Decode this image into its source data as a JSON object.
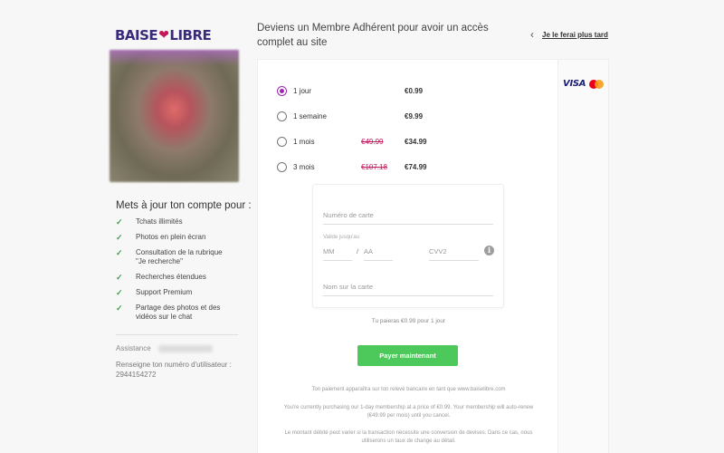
{
  "logo": {
    "word1": "BAISE",
    "heart": "❤",
    "word2": "LIBRE"
  },
  "sidebar": {
    "upgrade_title": "Mets à jour ton compte pour :",
    "features": [
      "Tchats illimités",
      "Photos en plein écran",
      "Consultation de la rubrique \"Je recherche\"",
      "Recherches étendues",
      "Support Premium",
      "Partage des photos et des vidéos sur le chat"
    ],
    "assistance_label": "Assistance",
    "user_number_label": "Renseigne ton numéro d'utilisateur :",
    "user_number": "2944154272"
  },
  "header": {
    "title": "Deviens un Membre Adhérent pour avoir un accès complet au site",
    "later_link": "Je le ferai plus tard"
  },
  "plans": [
    {
      "label": "1 jour",
      "old_price": "",
      "price": "€0.99",
      "selected": true
    },
    {
      "label": "1 semaine",
      "old_price": "",
      "price": "€9.99",
      "selected": false
    },
    {
      "label": "1 mois",
      "old_price": "€49.99",
      "price": "€34.99",
      "selected": false
    },
    {
      "label": "3 mois",
      "old_price": "€107.18",
      "price": "€74.99",
      "selected": false
    }
  ],
  "card_form": {
    "card_number_placeholder": "Numéro de carte",
    "valid_until_label": "Valide jusqu'au",
    "mm_placeholder": "MM",
    "slash": "/",
    "aa_placeholder": "AA",
    "cvv_placeholder": "CVV2",
    "info_glyph": "i",
    "name_placeholder": "Nom sur la carte"
  },
  "payment": {
    "summary": "Tu paieras €0.99 pour 1 jour",
    "pay_button": "Payer maintenant",
    "statement_note": "Ton paiement apparaîtra sur ton relevé bancaire en tant que www.baiselibre.com",
    "recurring_note": "You're currently purchasing our 1-day membership at a price of €0.99. Your membership will auto-renew (€49.99 per mois) until you cancel.",
    "currency_note": "Le montant débité peut varier si la transaction nécessite une conversion de devises. Dans ce cas, nous utiliserons un taux de change au détail."
  },
  "card_brands": {
    "visa": "VISA"
  },
  "colors": {
    "accent_purple": "#9c27b0",
    "pay_green": "#4cc95a",
    "strike_red": "#c2185b",
    "check_green": "#3fa04d"
  }
}
